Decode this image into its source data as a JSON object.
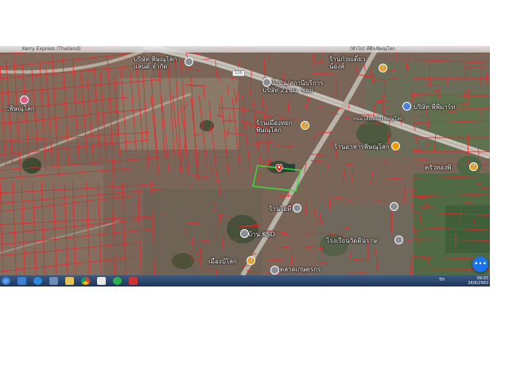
{
  "browser": {
    "tab_partial": "Kerry Express (Thailand)",
    "omnibox_partial": "(ทั่วไป) ที่ดินพิษณุโลก"
  },
  "map": {
    "labels": {
      "company": "บริษัท พิษณุโลก\nแลนด์ จำกัด",
      "noodle": "ร้านก๋วยเตี๋ยว\nน้องส์",
      "pcc": "บริษัท พีพีมาร์ท",
      "hospital_left": "...พิษณุโลก",
      "office": "ปั๊มน้ำมัน/สถานีบริการ\nบริษัท 21นม. ซอย",
      "road_name": "ถนน เลี่ยงเมืองพิษณุโลก",
      "restaurant_main": "ร้านเมืองหยก\nพิษณุโลก",
      "shop_mid": "ร้านอาหารพิษณุโลก",
      "kitchen": "ครัวทองพิ",
      "shop_center": "ร้านไอที",
      "ksd": "บ้าน KSD",
      "school": "โรงเรียนวัดดินราษ",
      "bottom_place": "เมืองป์โลก",
      "market": "ตลาดเกษตรกร"
    },
    "road_shield": "126",
    "fab_icon": "more-icon",
    "fab_text": "•••"
  },
  "taskbar": {
    "lang": "TH",
    "time": "09:03",
    "date": "26/6/2563"
  },
  "colors": {
    "parcel_line": "#e8262a",
    "selected_parcel": "#3cdc3c",
    "taskbar": "#1e3557",
    "fab": "#1a73e8"
  }
}
